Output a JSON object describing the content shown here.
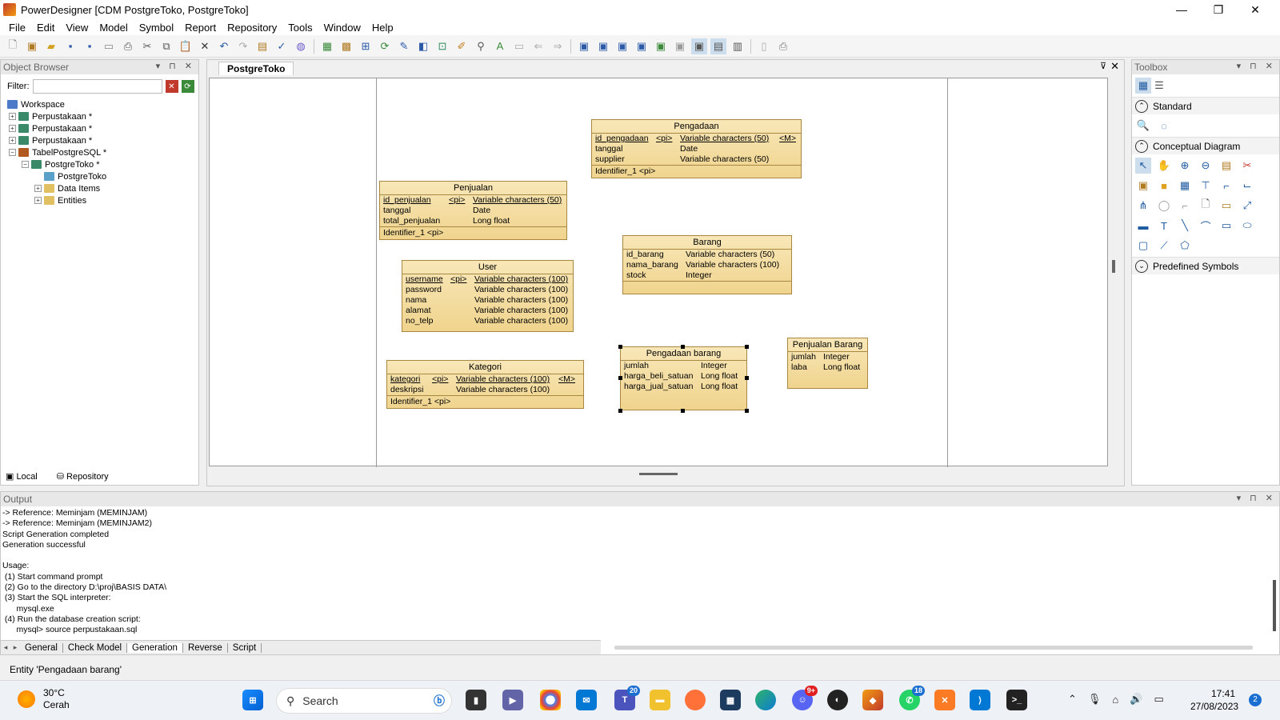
{
  "window": {
    "title": "PowerDesigner [CDM PostgreToko, PostgreToko]",
    "minimize": "—",
    "restore": "❐",
    "close": "✕"
  },
  "menu": [
    "File",
    "Edit",
    "View",
    "Model",
    "Symbol",
    "Report",
    "Repository",
    "Tools",
    "Window",
    "Help"
  ],
  "object_browser": {
    "title": "Object Browser",
    "filter_label": "Filter:",
    "tree": [
      {
        "label": "Workspace",
        "level": 0,
        "expander": ""
      },
      {
        "label": "Perpustakaan *",
        "level": 1,
        "expander": "+"
      },
      {
        "label": "Perpustakaan *",
        "level": 1,
        "expander": "+"
      },
      {
        "label": "Perpustakaan *",
        "level": 1,
        "expander": "+"
      },
      {
        "label": "TabelPostgreSQL *",
        "level": 1,
        "expander": "−"
      },
      {
        "label": "PostgreToko *",
        "level": 2,
        "expander": "−"
      },
      {
        "label": "PostgreToko",
        "level": 3,
        "expander": ""
      },
      {
        "label": "Data Items",
        "level": 3,
        "expander": "+"
      },
      {
        "label": "Entities",
        "level": 3,
        "expander": "+"
      }
    ],
    "tab_local": "Local",
    "tab_repository": "Repository"
  },
  "diagram": {
    "tab": "PostgreToko",
    "entities": {
      "pengadaan": {
        "name": "Pengadaan",
        "rows": [
          [
            "id_pengadaan",
            "<pi>",
            "Variable characters (50)",
            "<M>"
          ],
          [
            "tanggal",
            "",
            "Date",
            ""
          ],
          [
            "supplier",
            "",
            "Variable characters (50)",
            ""
          ]
        ],
        "identifier": "Identifier_1   <pi>"
      },
      "penjualan": {
        "name": "Penjualan",
        "rows": [
          [
            "id_penjualan",
            "<pi>",
            "Variable characters (50)",
            ""
          ],
          [
            "tanggal",
            "",
            "Date",
            ""
          ],
          [
            "total_penjualan",
            "",
            "Long float",
            ""
          ]
        ],
        "identifier": "Identifier_1   <pi>"
      },
      "barang": {
        "name": "Barang",
        "rows": [
          [
            "id_barang",
            "",
            "Variable characters (50)",
            ""
          ],
          [
            "nama_barang",
            "",
            "Variable characters (100)",
            ""
          ],
          [
            "stock",
            "",
            "Integer",
            ""
          ]
        ],
        "identifier": ""
      },
      "user": {
        "name": "User",
        "rows": [
          [
            "username",
            "<pi>",
            "Variable characters (100)",
            ""
          ],
          [
            "password",
            "",
            "Variable characters (100)",
            ""
          ],
          [
            "nama",
            "",
            "Variable characters (100)",
            ""
          ],
          [
            "alamat",
            "",
            "Variable characters (100)",
            ""
          ],
          [
            "no_telp",
            "",
            "Variable characters (100)",
            ""
          ]
        ],
        "identifier": ""
      },
      "kategori": {
        "name": "Kategori",
        "rows": [
          [
            "kategori",
            "<pi>",
            "Variable characters (100)",
            "<M>"
          ],
          [
            "deskripsi",
            "",
            "Variable characters (100)",
            ""
          ]
        ],
        "identifier": "Identifier_1   <pi>"
      },
      "pengadaan_barang": {
        "name": "Pengadaan barang",
        "rows": [
          [
            "jumlah",
            "",
            "Integer",
            ""
          ],
          [
            "harga_beli_satuan",
            "",
            "Long float",
            ""
          ],
          [
            "harga_jual_satuan",
            "",
            "Long float",
            ""
          ]
        ],
        "identifier": ""
      },
      "penjualan_barang": {
        "name": "Penjualan Barang",
        "rows": [
          [
            "jumlah",
            "",
            "Integer",
            ""
          ],
          [
            "laba",
            "",
            "Long float",
            ""
          ]
        ],
        "identifier": ""
      }
    }
  },
  "toolbox": {
    "title": "Toolbox",
    "sections": {
      "standard": "Standard",
      "conceptual": "Conceptual Diagram",
      "predefined": "Predefined Symbols"
    }
  },
  "output": {
    "title": "Output",
    "lines": "-> Reference: Meminjam (MEMINJAM)\n-> Reference: Meminjam (MEMINJAM2)\nScript Generation completed\nGeneration successful\n\nUsage:\n (1) Start command prompt\n (2) Go to the directory D:\\proj\\BASIS DATA\\\n (3) Start the SQL interpreter:\n      mysql.exe\n (4) Run the database creation script:\n      mysql> source perpustakaan.sql",
    "tabs": [
      "General",
      "Check Model",
      "Generation",
      "Reverse",
      "Script"
    ]
  },
  "status": "Entity 'Pengadaan barang'",
  "taskbar": {
    "temp": "30°C",
    "condition": "Cerah",
    "search": "Search",
    "badge_teams": "20",
    "badge_discord": "9+",
    "badge_whatsapp": "18",
    "time": "17:41",
    "date": "27/08/2023",
    "notifications": "2"
  }
}
